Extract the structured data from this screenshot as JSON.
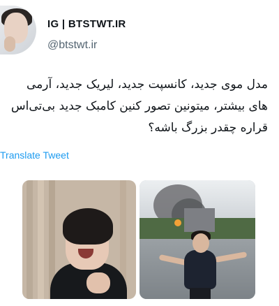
{
  "header": {
    "display_name": "IG | BTSTWT.IR",
    "handle": "@btstwt.ir"
  },
  "tweet": {
    "text": "مدل موی جدید، کانسپت جدید، لیریک جدید، آرمی های بیشتر، میتونین تصور کنین کامبک جدید بی‌تی‌اس قراره چقدر بزرگ باشه؟"
  },
  "translate": {
    "label": "Translate Tweet"
  },
  "colors": {
    "link": "#1d9bf0",
    "secondary_text": "#536471",
    "primary_text": "#0f1419"
  }
}
